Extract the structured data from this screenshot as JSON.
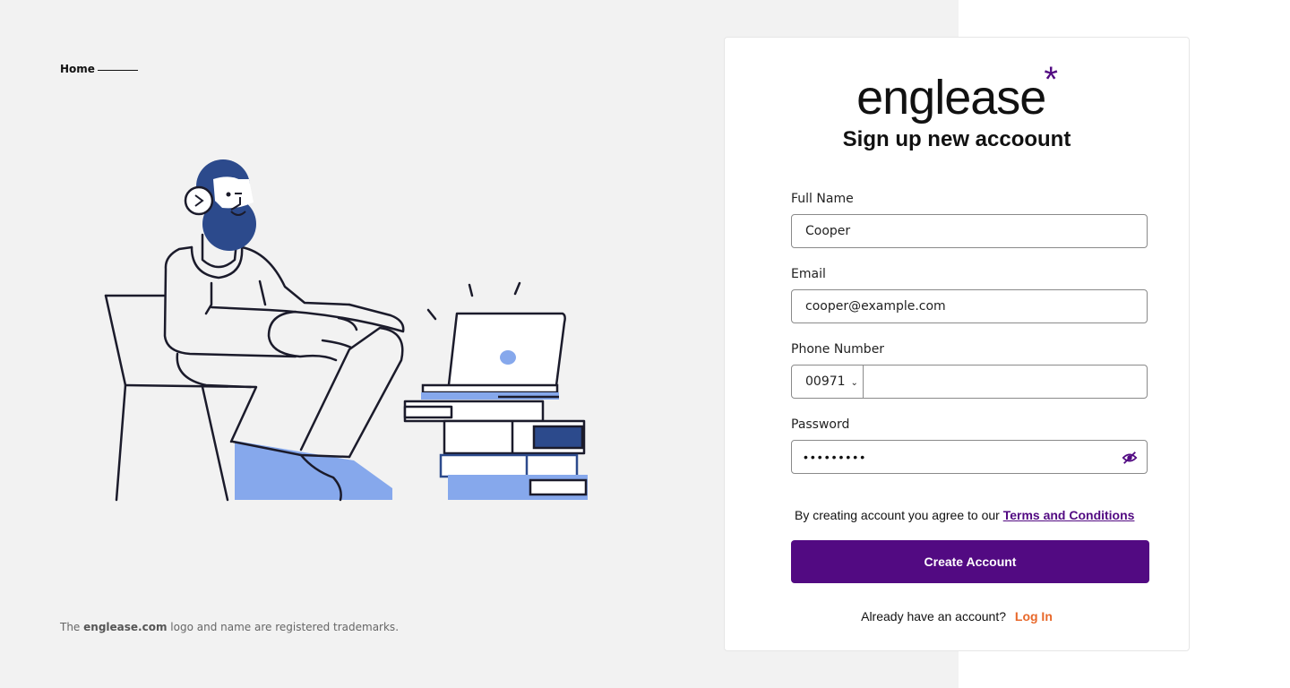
{
  "nav": {
    "home_label": "Home"
  },
  "footer": {
    "trademark_prefix": "The ",
    "trademark_brand": "englease.com",
    "trademark_suffix": " logo and name are registered trademarks."
  },
  "brand": {
    "logo_text": "englease",
    "logo_star": "*",
    "accent_color": "#520a82",
    "login_color": "#e8682a"
  },
  "form": {
    "title": "Sign up new accoount",
    "full_name": {
      "label": "Full Name",
      "value": "Cooper"
    },
    "email": {
      "label": "Email",
      "value": "cooper@example.com"
    },
    "phone": {
      "label": "Phone Number",
      "country_code": "00971",
      "value": ""
    },
    "password": {
      "label": "Password",
      "masked": "•••••••••",
      "toggle_icon": "eye-off-icon"
    },
    "terms_text": "By creating account you agree to our",
    "terms_link": "Terms and Conditions",
    "submit_label": "Create Account",
    "login_prompt": "Already have an account?",
    "login_link": "Log In"
  }
}
